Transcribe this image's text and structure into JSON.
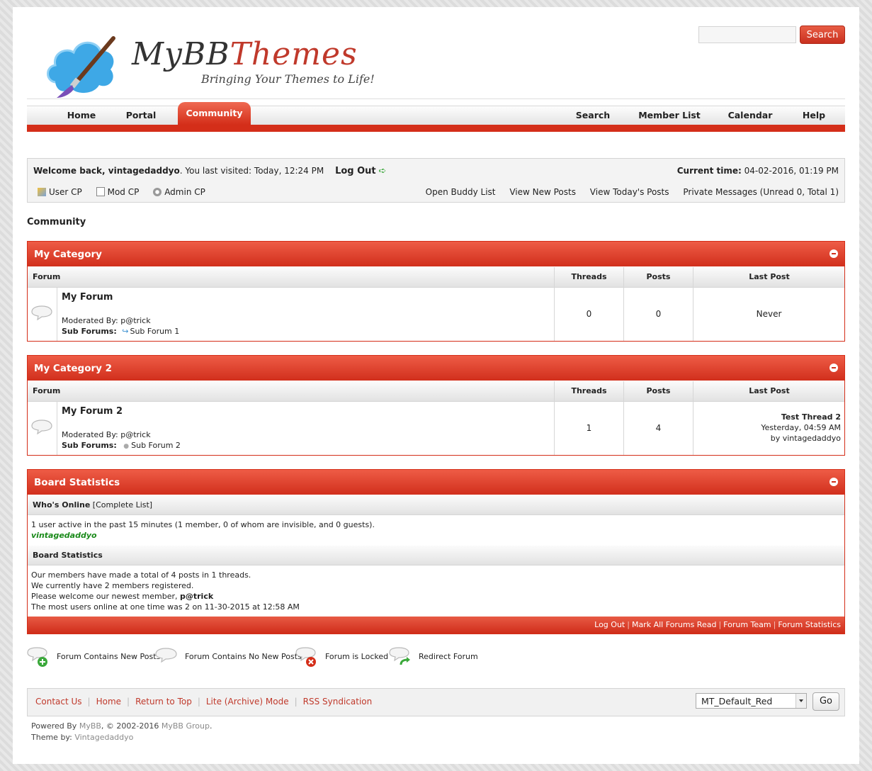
{
  "header": {
    "logo_text_a": "MyBB",
    "logo_text_b": "Themes",
    "tagline": "Bringing Your Themes to Life!",
    "search_button": "Search",
    "search_placeholder": ""
  },
  "nav": {
    "items": [
      {
        "label": "Home"
      },
      {
        "label": "Portal"
      },
      {
        "label": "Community"
      },
      {
        "label": "Search"
      },
      {
        "label": "Member List"
      },
      {
        "label": "Calendar"
      },
      {
        "label": "Help"
      }
    ],
    "active": "Community"
  },
  "welcome": {
    "greeting": "Welcome back, vintagedaddyo",
    "last_visited": ". You last visited: Today, 12:24 PM",
    "logout": "Log Out",
    "current_time_label": "Current time:",
    "current_time_value": "04-02-2016, 01:19 PM",
    "user_cp": "User CP",
    "mod_cp": "Mod CP",
    "admin_cp": "Admin CP",
    "buddy_list": "Open Buddy List",
    "new_posts": "View New Posts",
    "todays_posts": "View Today's Posts",
    "private_messages": "Private Messages (Unread 0, Total 1)"
  },
  "breadcrumb": "Community",
  "columns": {
    "forum": "Forum",
    "threads": "Threads",
    "posts": "Posts",
    "last_post": "Last Post"
  },
  "categories": [
    {
      "title": "My Category",
      "forum": {
        "name": "My Forum",
        "moderated_by_label": "Moderated By:",
        "moderator": "p@trick",
        "sub_forums_label": "Sub Forums:",
        "sub_forum": "Sub Forum 1",
        "threads": "0",
        "posts": "0",
        "last_post": "Never"
      }
    },
    {
      "title": "My Category 2",
      "forum": {
        "name": "My Forum 2",
        "moderated_by_label": "Moderated By:",
        "moderator": "p@trick",
        "sub_forums_label": "Sub Forums:",
        "sub_forum": "Sub Forum 2",
        "threads": "1",
        "posts": "4",
        "last_post_thread": "Test Thread 2",
        "last_post_time": "Yesterday, 04:59 AM",
        "last_post_by": "by vintagedaddyo"
      }
    }
  ],
  "stats": {
    "title": "Board Statistics",
    "whos_online_label": "Who's Online",
    "complete_list": "[Complete List]",
    "online_text": "1 user active in the past 15 minutes (1 member, 0 of whom are invisible, and 0 guests).",
    "online_user": "vintagedaddyo",
    "board_stats_label": "Board Statistics",
    "line1": "Our members have made a total of 4 posts in 1 threads.",
    "line2": "We currently have 2 members registered.",
    "line3_prefix": "Please welcome our newest member, ",
    "newest_member": "p@trick",
    "line4": "The most users online at one time was 2 on 11-30-2015 at 12:58 AM",
    "footer_links": [
      "Log Out",
      "Mark All Forums Read",
      "Forum Team",
      "Forum Statistics"
    ]
  },
  "legend": {
    "new_posts": "Forum Contains New Posts",
    "no_new_posts": "Forum Contains No New Posts",
    "locked": "Forum is Locked",
    "redirect": "Redirect Forum"
  },
  "footer": {
    "links": [
      "Contact Us",
      "Home",
      "Return to Top",
      "Lite (Archive) Mode",
      "RSS Syndication"
    ],
    "theme_selected": "MT_Default_Red",
    "go": "Go",
    "powered_prefix": "Powered By ",
    "powered_mybb": "MyBB",
    "powered_suffix": ", © 2002-2016 ",
    "powered_group": "MyBB Group",
    "powered_end": ".",
    "theme_by_label": "Theme by: ",
    "theme_author": "Vintagedaddyo"
  },
  "colors": {
    "accent": "#d42e19",
    "online_user": "#1a8a1a"
  }
}
